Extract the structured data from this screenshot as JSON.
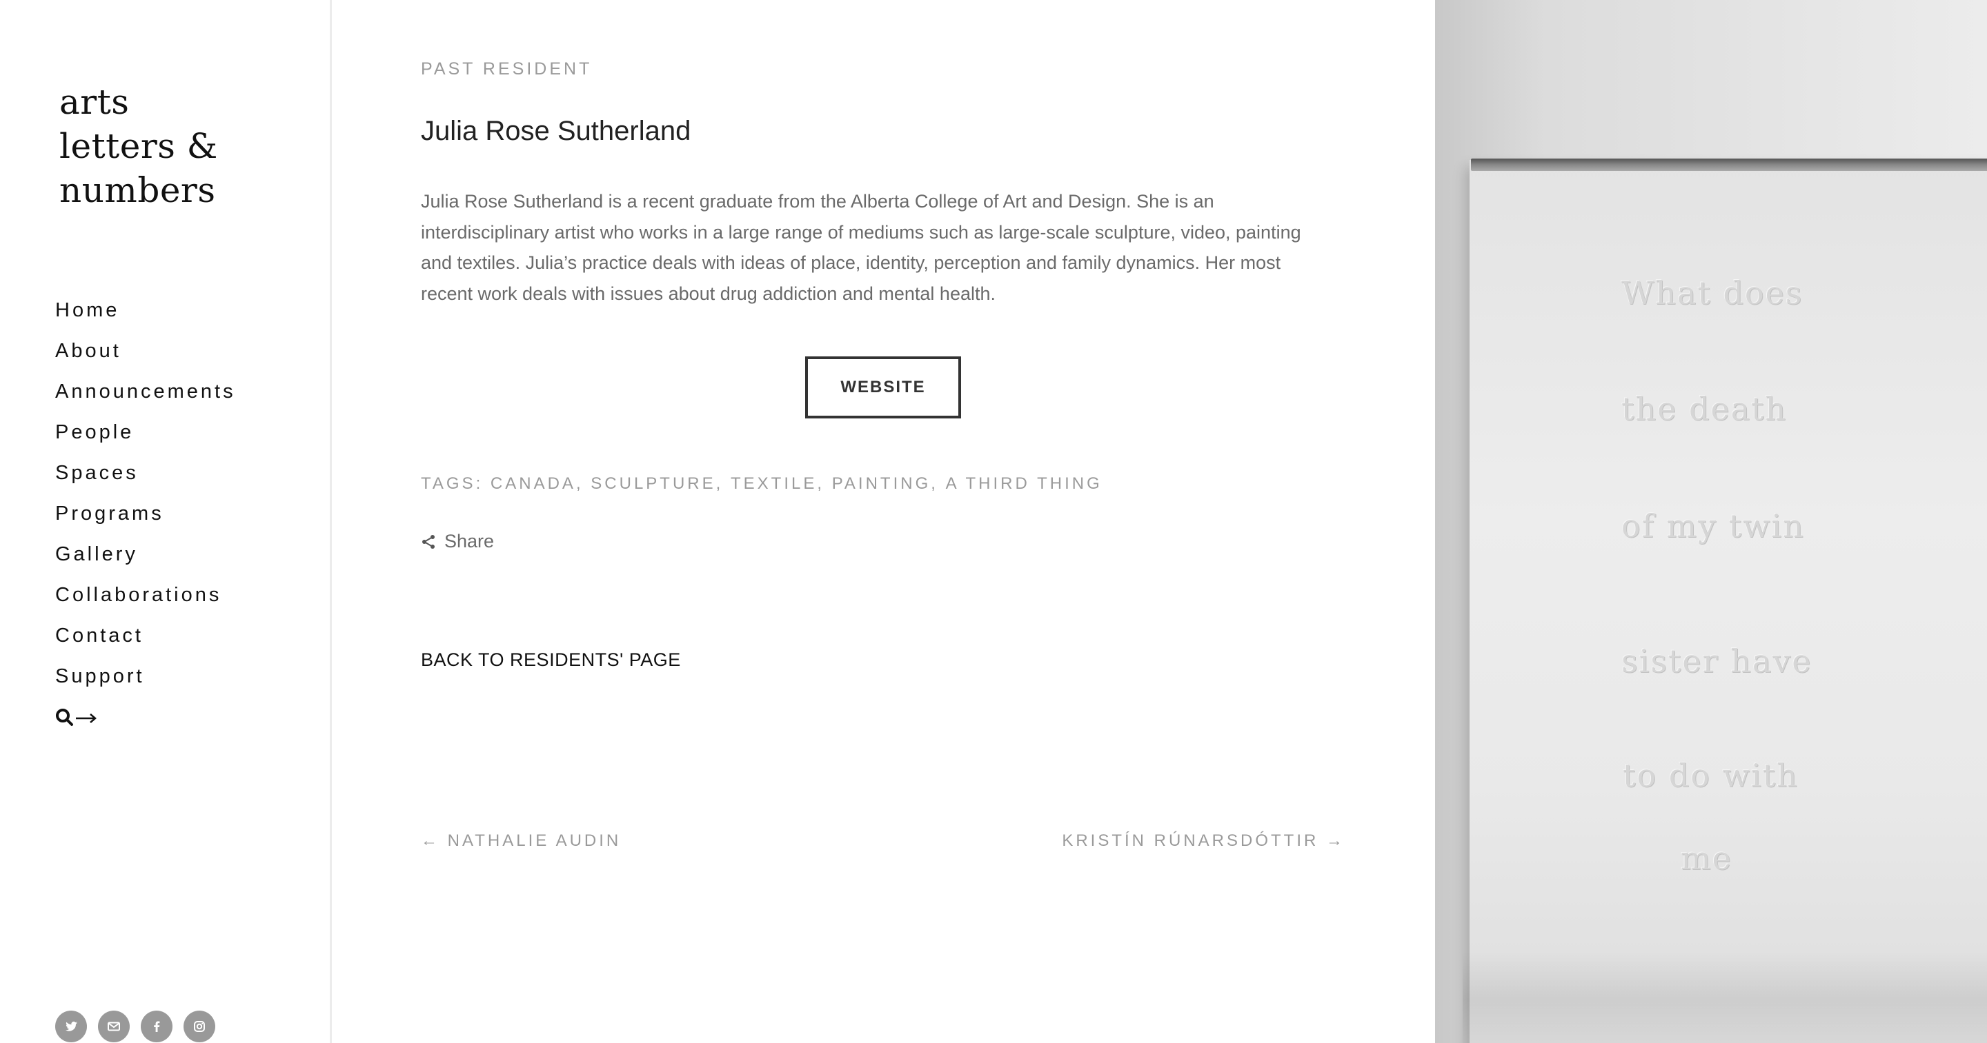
{
  "brand": {
    "logo_lines": [
      "arts",
      "letters &",
      "numbers"
    ]
  },
  "sidebar": {
    "nav": [
      {
        "label": "Home"
      },
      {
        "label": "About"
      },
      {
        "label": "Announcements"
      },
      {
        "label": "People"
      },
      {
        "label": "Spaces"
      },
      {
        "label": "Programs"
      },
      {
        "label": "Gallery"
      },
      {
        "label": "Collaborations"
      },
      {
        "label": "Contact"
      },
      {
        "label": "Support"
      }
    ],
    "search_icon": "search-arrow-icon",
    "socials": [
      {
        "icon": "twitter-icon"
      },
      {
        "icon": "email-icon"
      },
      {
        "icon": "facebook-icon"
      },
      {
        "icon": "instagram-icon"
      }
    ]
  },
  "main": {
    "eyebrow": "PAST RESIDENT",
    "name": "Julia Rose Sutherland",
    "bio": "Julia Rose Sutherland is a recent graduate from the Alberta College of Art and Design. She is an interdisciplinary artist who works in a large range of mediums such as large-scale sculpture, video, painting and textiles. Julia’s practice deals with ideas of place, identity, perception and family dynamics. Her most recent work deals with issues about drug addiction and mental health.",
    "website_label": "WEBSITE",
    "tags_prefix": "TAGS:",
    "tags": [
      "CANADA",
      "SCULPTURE",
      "TEXTILE",
      "PAINTING",
      "A THIRD THING"
    ],
    "share_label": "Share",
    "back_label": "BACK TO RESIDENTS' PAGE",
    "prev_label": "← NATHALIE AUDIN",
    "next_label": "KRISTÍN RÚNARSDÓTTIR →"
  },
  "artwork": {
    "lines": [
      "What does",
      "the death",
      "of my twin",
      "sister have",
      "to do with",
      "me"
    ]
  },
  "colors": {
    "muted_text": "#9a9a9a",
    "body_text": "#6a6a6a",
    "social_bg": "#999999",
    "button_border": "#333333"
  }
}
